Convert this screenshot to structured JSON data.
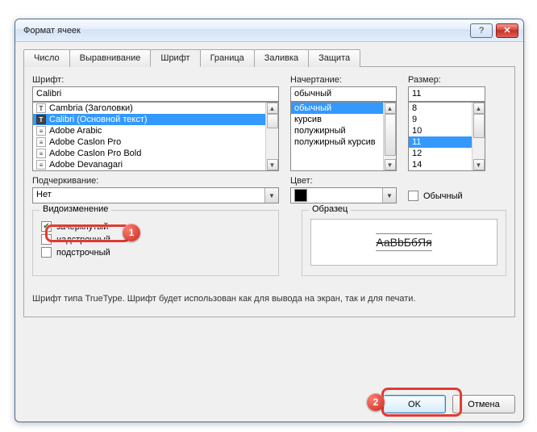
{
  "window": {
    "title": "Формат ячеек",
    "help_tooltip": "Справка",
    "close_tooltip": "Закрыть"
  },
  "tabs": [
    "Число",
    "Выравнивание",
    "Шрифт",
    "Граница",
    "Заливка",
    "Защита"
  ],
  "active_tab_index": 2,
  "font": {
    "label": "Шрифт:",
    "value": "Calibri",
    "list": [
      {
        "name": "Cambria (Заголовки)",
        "type": "ot"
      },
      {
        "name": "Calibri (Основной текст)",
        "type": "ot",
        "selected": true
      },
      {
        "name": "Adobe Arabic",
        "type": "tt"
      },
      {
        "name": "Adobe Caslon Pro",
        "type": "tt"
      },
      {
        "name": "Adobe Caslon Pro Bold",
        "type": "tt"
      },
      {
        "name": "Adobe Devanagari",
        "type": "tt"
      }
    ]
  },
  "style": {
    "label": "Начертание:",
    "value": "обычный",
    "list": [
      {
        "name": "обычный",
        "selected": true
      },
      {
        "name": "курсив"
      },
      {
        "name": "полужирный"
      },
      {
        "name": "полужирный курсив"
      }
    ]
  },
  "size": {
    "label": "Размер:",
    "value": "11",
    "list": [
      {
        "name": "8"
      },
      {
        "name": "9"
      },
      {
        "name": "10"
      },
      {
        "name": "11",
        "selected": true
      },
      {
        "name": "12"
      },
      {
        "name": "14"
      }
    ]
  },
  "underline": {
    "label": "Подчеркивание:",
    "value": "Нет"
  },
  "color": {
    "label": "Цвет:",
    "value": "#000000",
    "normal_label": "Обычный",
    "normal_checked": false
  },
  "effects": {
    "legend": "Видоизменение",
    "strike": {
      "label": "зачеркнутый",
      "checked": true
    },
    "super": {
      "label": "надстрочный",
      "checked": false
    },
    "sub": {
      "label": "подстрочный",
      "checked": false
    }
  },
  "preview": {
    "legend": "Образец",
    "sample_text": "АаВbБбЯя"
  },
  "hint": "Шрифт типа TrueType. Шрифт будет использован как для вывода на экран, так и для печати.",
  "buttons": {
    "ok": "OK",
    "cancel": "Отмена"
  },
  "annotations": {
    "badge1": "1",
    "badge2": "2"
  }
}
